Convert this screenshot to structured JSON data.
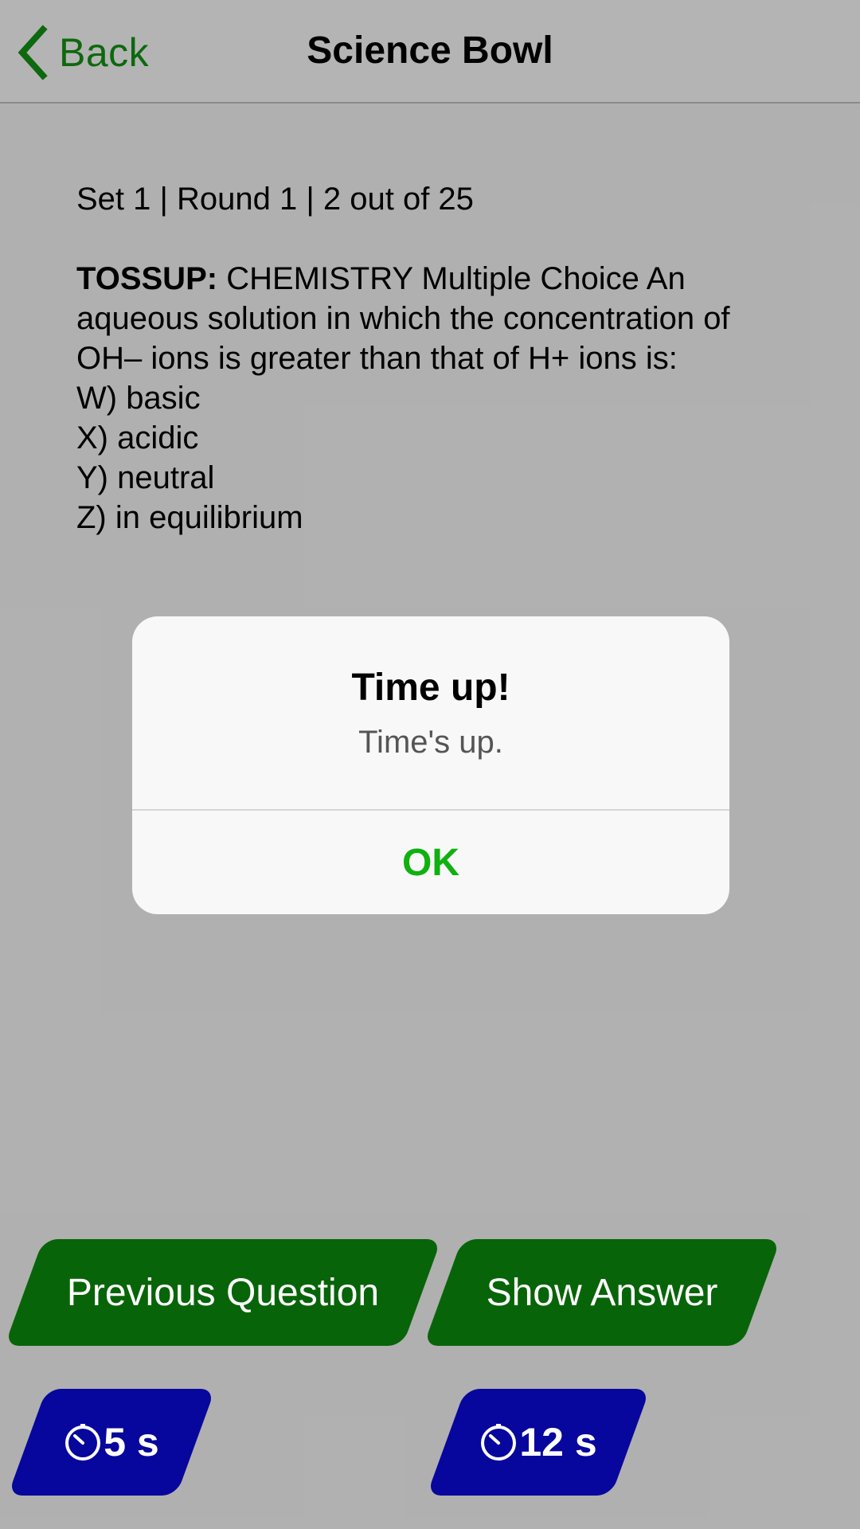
{
  "header": {
    "back_label": "Back",
    "title": "Science Bowl"
  },
  "question": {
    "meta": "Set 1 | Round 1 | 2 out of 25",
    "type_label": "TOSSUP:",
    "text_line1": " CHEMISTRY Multiple Choice An",
    "text_line2": "aqueous solution in which the concentration of",
    "text_line3": "OH– ions is greater than that of H+ ions is:",
    "choices": [
      "W) basic",
      "X) acidic",
      "Y) neutral",
      "Z) in equilibrium"
    ]
  },
  "buttons": {
    "previous": "Previous Question",
    "show_answer": "Show Answer",
    "timer1": "5 s",
    "timer2": "12 s"
  },
  "dialog": {
    "title": "Time up!",
    "message": "Time's up.",
    "ok": "OK"
  },
  "colors": {
    "accent_green": "#0b8a0b",
    "timer_blue": "#0a0ad8",
    "ok_green": "#10b010"
  },
  "icons": {
    "back": "chevron-left-icon",
    "timer": "stopwatch-icon"
  }
}
